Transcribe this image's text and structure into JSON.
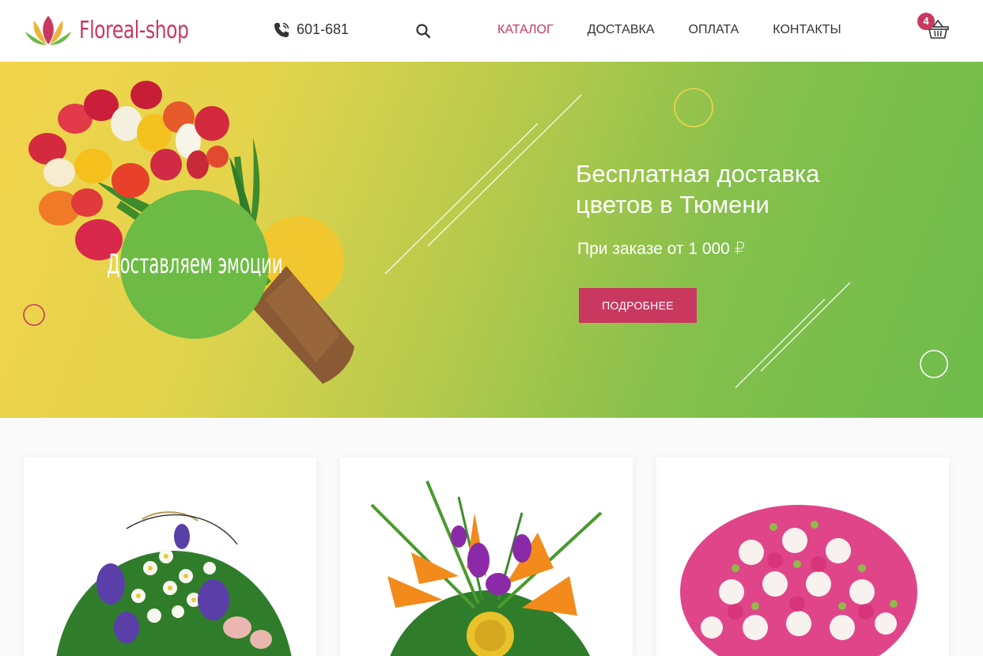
{
  "header": {
    "logo_text": "Floreal-shop",
    "phone": "601-681",
    "nav": [
      {
        "label": "КАТАЛОГ",
        "active": true
      },
      {
        "label": "ДОСТАВКА",
        "active": false
      },
      {
        "label": "ОПЛАТА",
        "active": false
      },
      {
        "label": "КОНТАКТЫ",
        "active": false
      }
    ],
    "cart_count": "4"
  },
  "hero": {
    "badge": "Доставляем эмоции",
    "title": "Бесплатная доставка цветов в Тюмени",
    "subtitle": "При заказе от 1 000 ₽",
    "button_label": "ПОДРОБНЕЕ"
  },
  "products": [
    {
      "icon": "bouquet-irises-image"
    },
    {
      "icon": "bouquet-exotic-image"
    },
    {
      "icon": "bouquet-roses-image"
    }
  ],
  "colors": {
    "accent": "#c8385f",
    "green": "#6dbb45",
    "yellow": "#f2d44c"
  }
}
